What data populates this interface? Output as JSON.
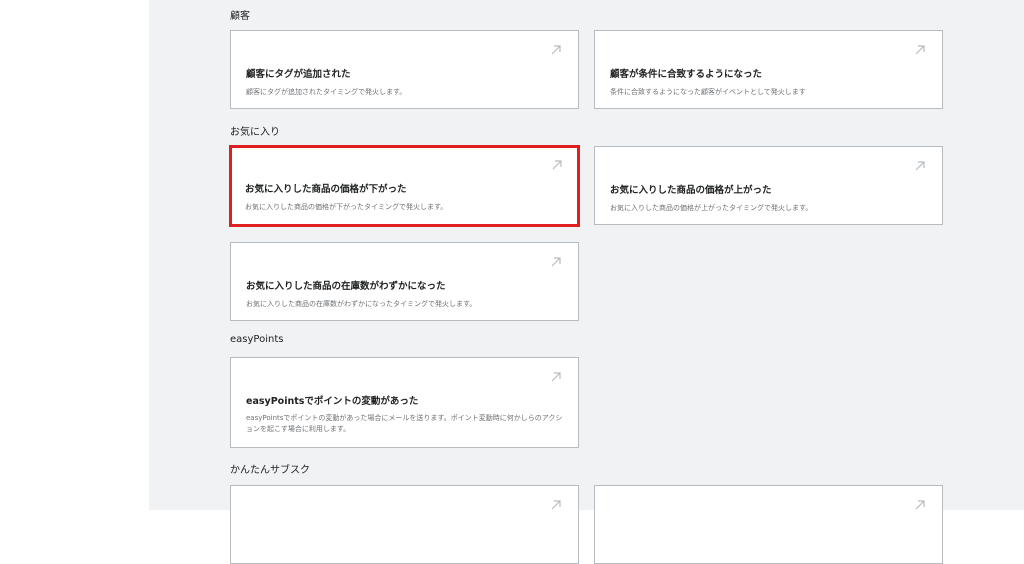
{
  "sections": [
    {
      "title": "顧客",
      "cards": [
        {
          "title": "顧客にタグが追加された",
          "desc": "顧客にタグが追加されたタイミングで発火します。"
        },
        {
          "title": "顧客が条件に合致するようになった",
          "desc": "条件に合致するようになった顧客がイベントとして発火します"
        }
      ]
    },
    {
      "title": "お気に入り",
      "cards": [
        {
          "title": "お気に入りした商品の価格が下がった",
          "desc": "お気に入りした商品の価格が下がったタイミングで発火します。"
        },
        {
          "title": "お気に入りした商品の価格が上がった",
          "desc": "お気に入りした商品の価格が上がったタイミングで発火します。"
        },
        {
          "title": "お気に入りした商品の在庫数がわずかになった",
          "desc": "お気に入りした商品の在庫数がわずかになったタイミングで発火します。"
        }
      ]
    },
    {
      "title": "easyPoints",
      "cards": [
        {
          "title": "easyPointsでポイントの変動があった",
          "desc": "easyPointsでポイントの変動があった場合にメールを送ります。ポイント変動時に何かしらのアクションを起こす場合に利用します。"
        }
      ]
    },
    {
      "title": "かんたんサブスク",
      "cards": [
        {
          "title": "",
          "desc": ""
        },
        {
          "title": "",
          "desc": ""
        }
      ]
    }
  ],
  "colors": {
    "highlight": "#e02020",
    "background": "#f1f2f4"
  },
  "icons": {
    "card_arrow": "arrow-up-right-icon"
  }
}
